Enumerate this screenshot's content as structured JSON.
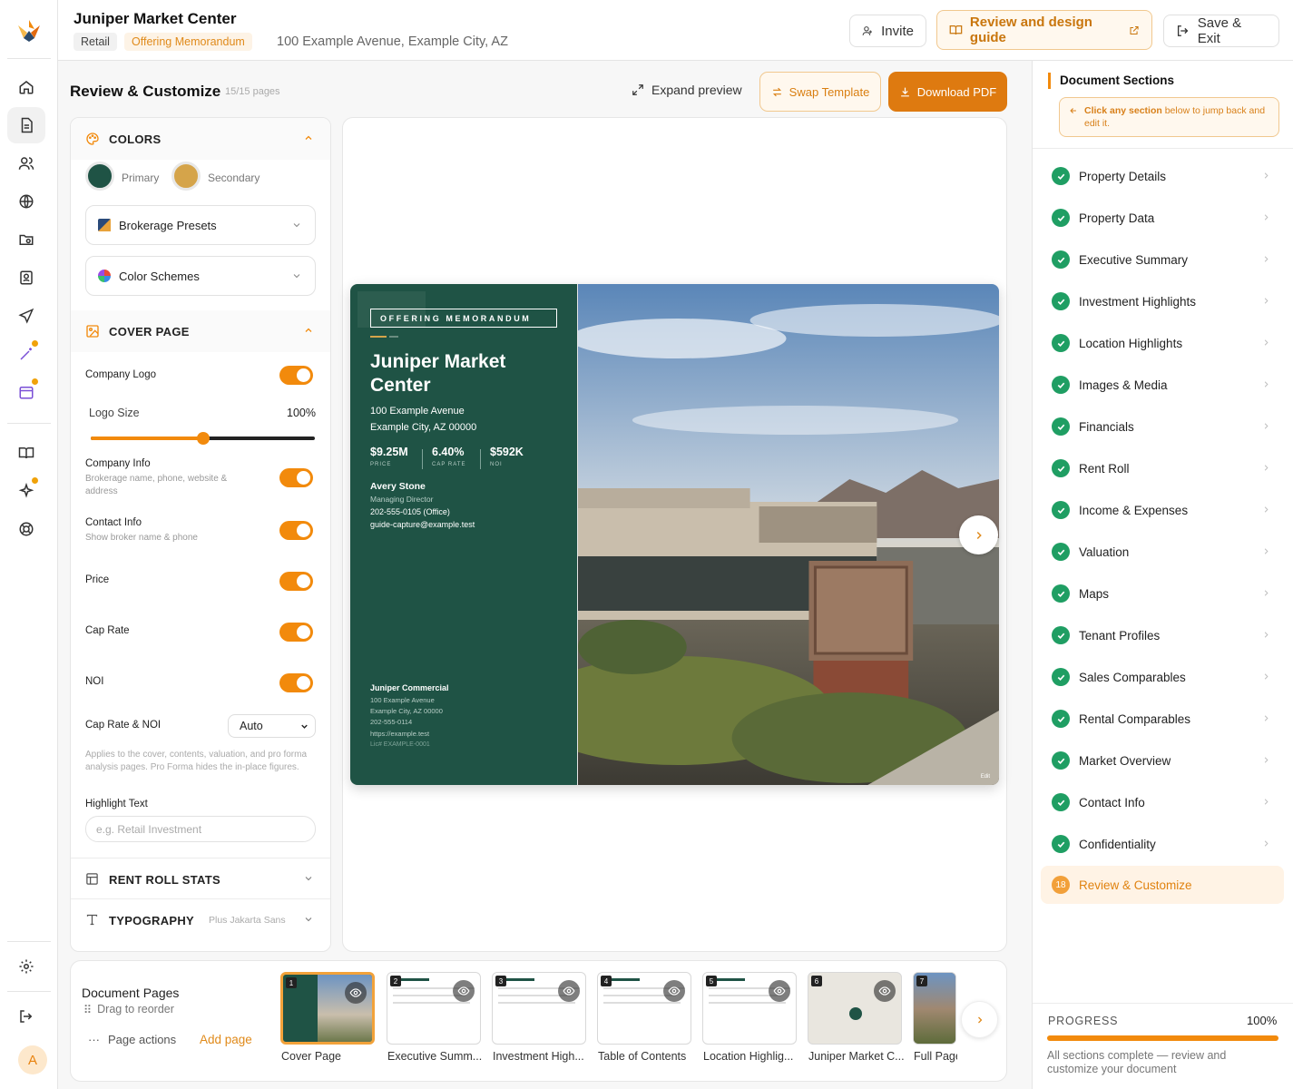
{
  "header": {
    "title": "Juniper Market Center",
    "tags": [
      "Retail",
      "Offering Memorandum"
    ],
    "address": "100 Example Avenue, Example City, AZ",
    "invite_label": "Invite",
    "guide_label": "Review and design guide",
    "save_label": "Save & Exit"
  },
  "rail": {
    "avatar": "A"
  },
  "customize": {
    "title": "Review & Customize",
    "pages_count": "15/15 pages",
    "expand_label": "Expand preview",
    "swap_label": "Swap Template",
    "download_label": "Download PDF"
  },
  "panel": {
    "colors": {
      "heading": "COLORS",
      "primary_label": "Primary",
      "secondary_label": "Secondary",
      "primary_color": "#1f5345",
      "secondary_color": "#d5a44a",
      "brokerage_presets": "Brokerage Presets",
      "color_schemes": "Color Schemes"
    },
    "cover": {
      "heading": "COVER PAGE",
      "company_logo": "Company Logo",
      "logo_size_label": "Logo Size",
      "logo_size_value": "100%",
      "logo_size_fraction": 0.5,
      "company_info": "Company Info",
      "company_info_sub": "Brokerage name, phone, website & address",
      "contact_info": "Contact Info",
      "contact_info_sub": "Show broker name & phone",
      "price": "Price",
      "cap_rate": "Cap Rate",
      "noi": "NOI",
      "cap_noi_label": "Cap Rate & NOI",
      "cap_noi_value": "Auto",
      "cap_noi_help": "Applies to the cover, contents, valuation, and pro forma analysis pages. Pro Forma hides the in-place figures.",
      "highlight_label": "Highlight Text",
      "highlight_placeholder": "e.g. Retail Investment"
    },
    "rent_roll": "RENT ROLL STATS",
    "typography": "TYPOGRAPHY",
    "typography_font": "Plus Jakarta Sans"
  },
  "cover_preview": {
    "om_tag": "OFFERING MEMORANDUM",
    "title": "Juniper Market Center",
    "address1": "100 Example Avenue",
    "address2": "Example City, AZ 00000",
    "price": "$9.25M",
    "price_label": "PRICE",
    "cap": "6.40%",
    "cap_label": "CAP RATE",
    "noi": "$592K",
    "noi_label": "NOI",
    "broker_name": "Avery Stone",
    "broker_title": "Managing Director",
    "broker_phone": "202-555-0105 (Office)",
    "broker_email": "guide-capture@example.test",
    "company": "Juniper Commercial",
    "company_addr1": "100 Example Avenue",
    "company_addr2": "Example City, AZ 00000",
    "company_phone": "202-555-0114",
    "company_url": "https://example.test",
    "company_lic": "Lic# EXAMPLE-0001",
    "edit": "Edit"
  },
  "doc_pages": {
    "title": "Document Pages",
    "drag": "Drag to reorder",
    "page_actions": "Page actions",
    "add_page": "Add page",
    "thumbs": [
      {
        "num": "1",
        "label": "Cover Page"
      },
      {
        "num": "2",
        "label": "Executive Summ..."
      },
      {
        "num": "3",
        "label": "Investment High..."
      },
      {
        "num": "4",
        "label": "Table of Contents"
      },
      {
        "num": "5",
        "label": "Location Highlig..."
      },
      {
        "num": "6",
        "label": "Juniper Market C..."
      },
      {
        "num": "7",
        "label": "Full Page"
      }
    ]
  },
  "sections": {
    "title": "Document Sections",
    "tip_bold": "Click any section",
    "tip_rest": " below to jump back and edit it.",
    "items": [
      "Property Details",
      "Property Data",
      "Executive Summary",
      "Investment Highlights",
      "Location Highlights",
      "Images & Media",
      "Financials",
      "Rent Roll",
      "Income & Expenses",
      "Valuation",
      "Maps",
      "Tenant Profiles",
      "Sales Comparables",
      "Rental Comparables",
      "Market Overview",
      "Contact Info",
      "Confidentiality"
    ],
    "active_num": "18",
    "active_label": "Review & Customize",
    "progress_label": "PROGRESS",
    "progress_value": "100%",
    "progress_fraction": 1.0,
    "progress_text": "All sections complete — review and customize your document"
  }
}
